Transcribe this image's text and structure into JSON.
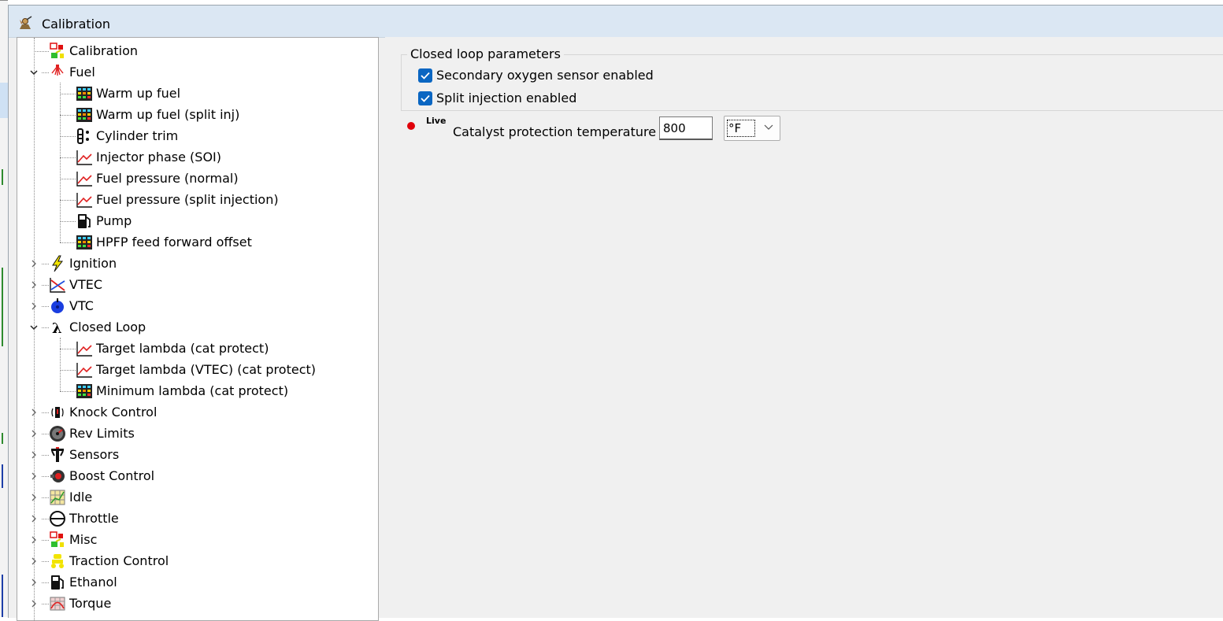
{
  "window": {
    "title": "Calibration"
  },
  "tree": [
    {
      "label": "Calibration",
      "level": 0,
      "expander": "none",
      "icon": "calibration-icon"
    },
    {
      "label": "Fuel",
      "level": 0,
      "expander": "expanded",
      "icon": "fuel-spray-icon"
    },
    {
      "label": "Warm up fuel",
      "level": 1,
      "expander": "none",
      "icon": "table-icon"
    },
    {
      "label": "Warm up fuel (split inj)",
      "level": 1,
      "expander": "none",
      "icon": "table-icon"
    },
    {
      "label": "Cylinder trim",
      "level": 1,
      "expander": "none",
      "icon": "cylinder-icon"
    },
    {
      "label": "Injector phase (SOI)",
      "level": 1,
      "expander": "none",
      "icon": "graph-icon"
    },
    {
      "label": "Fuel pressure (normal)",
      "level": 1,
      "expander": "none",
      "icon": "graph-icon"
    },
    {
      "label": "Fuel pressure (split injection)",
      "level": 1,
      "expander": "none",
      "icon": "graph-icon"
    },
    {
      "label": "Pump",
      "level": 1,
      "expander": "none",
      "icon": "fuel-pump-icon"
    },
    {
      "label": "HPFP feed forward offset",
      "level": 1,
      "expander": "none",
      "icon": "table-icon"
    },
    {
      "label": "Ignition",
      "level": 0,
      "expander": "collapsed",
      "icon": "lightning-icon"
    },
    {
      "label": "VTEC",
      "level": 0,
      "expander": "collapsed",
      "icon": "vtec-graph-icon"
    },
    {
      "label": "VTC",
      "level": 0,
      "expander": "collapsed",
      "icon": "vtc-gear-icon"
    },
    {
      "label": "Closed Loop",
      "level": 0,
      "expander": "expanded",
      "icon": "lambda-icon"
    },
    {
      "label": "Target lambda (cat protect)",
      "level": 1,
      "expander": "none",
      "icon": "graph-icon"
    },
    {
      "label": "Target lambda (VTEC) (cat protect)",
      "level": 1,
      "expander": "none",
      "icon": "graph-icon"
    },
    {
      "label": "Minimum lambda (cat protect)",
      "level": 1,
      "expander": "none",
      "icon": "table-icon"
    },
    {
      "label": "Knock Control",
      "level": 0,
      "expander": "collapsed",
      "icon": "knock-sensor-icon"
    },
    {
      "label": "Rev Limits",
      "level": 0,
      "expander": "collapsed",
      "icon": "tachometer-icon"
    },
    {
      "label": "Sensors",
      "level": 0,
      "expander": "collapsed",
      "icon": "sensor-icon"
    },
    {
      "label": "Boost Control",
      "level": 0,
      "expander": "collapsed",
      "icon": "turbo-icon"
    },
    {
      "label": "Idle",
      "level": 0,
      "expander": "collapsed",
      "icon": "idle-grid-icon"
    },
    {
      "label": "Throttle",
      "level": 0,
      "expander": "collapsed",
      "icon": "throttle-icon"
    },
    {
      "label": "Misc",
      "level": 0,
      "expander": "collapsed",
      "icon": "calibration-icon"
    },
    {
      "label": "Traction Control",
      "level": 0,
      "expander": "collapsed",
      "icon": "traction-icon"
    },
    {
      "label": "Ethanol",
      "level": 0,
      "expander": "collapsed",
      "icon": "fuel-pump-icon"
    },
    {
      "label": "Torque",
      "level": 0,
      "expander": "collapsed",
      "icon": "torque-table-icon"
    }
  ],
  "panel": {
    "group_title": "Closed loop parameters",
    "secondary_o2": {
      "label": "Secondary oxygen sensor enabled",
      "checked": true
    },
    "split_injection": {
      "label": "Split injection enabled",
      "checked": true
    },
    "live_label": "Live",
    "cat_temp": {
      "label": "Catalyst protection temperature",
      "value": "800",
      "unit": "°F"
    }
  },
  "colors": {
    "accent": "#0a66c2",
    "live_indicator": "#e0000a",
    "titlebar": "#dbe7f3"
  }
}
